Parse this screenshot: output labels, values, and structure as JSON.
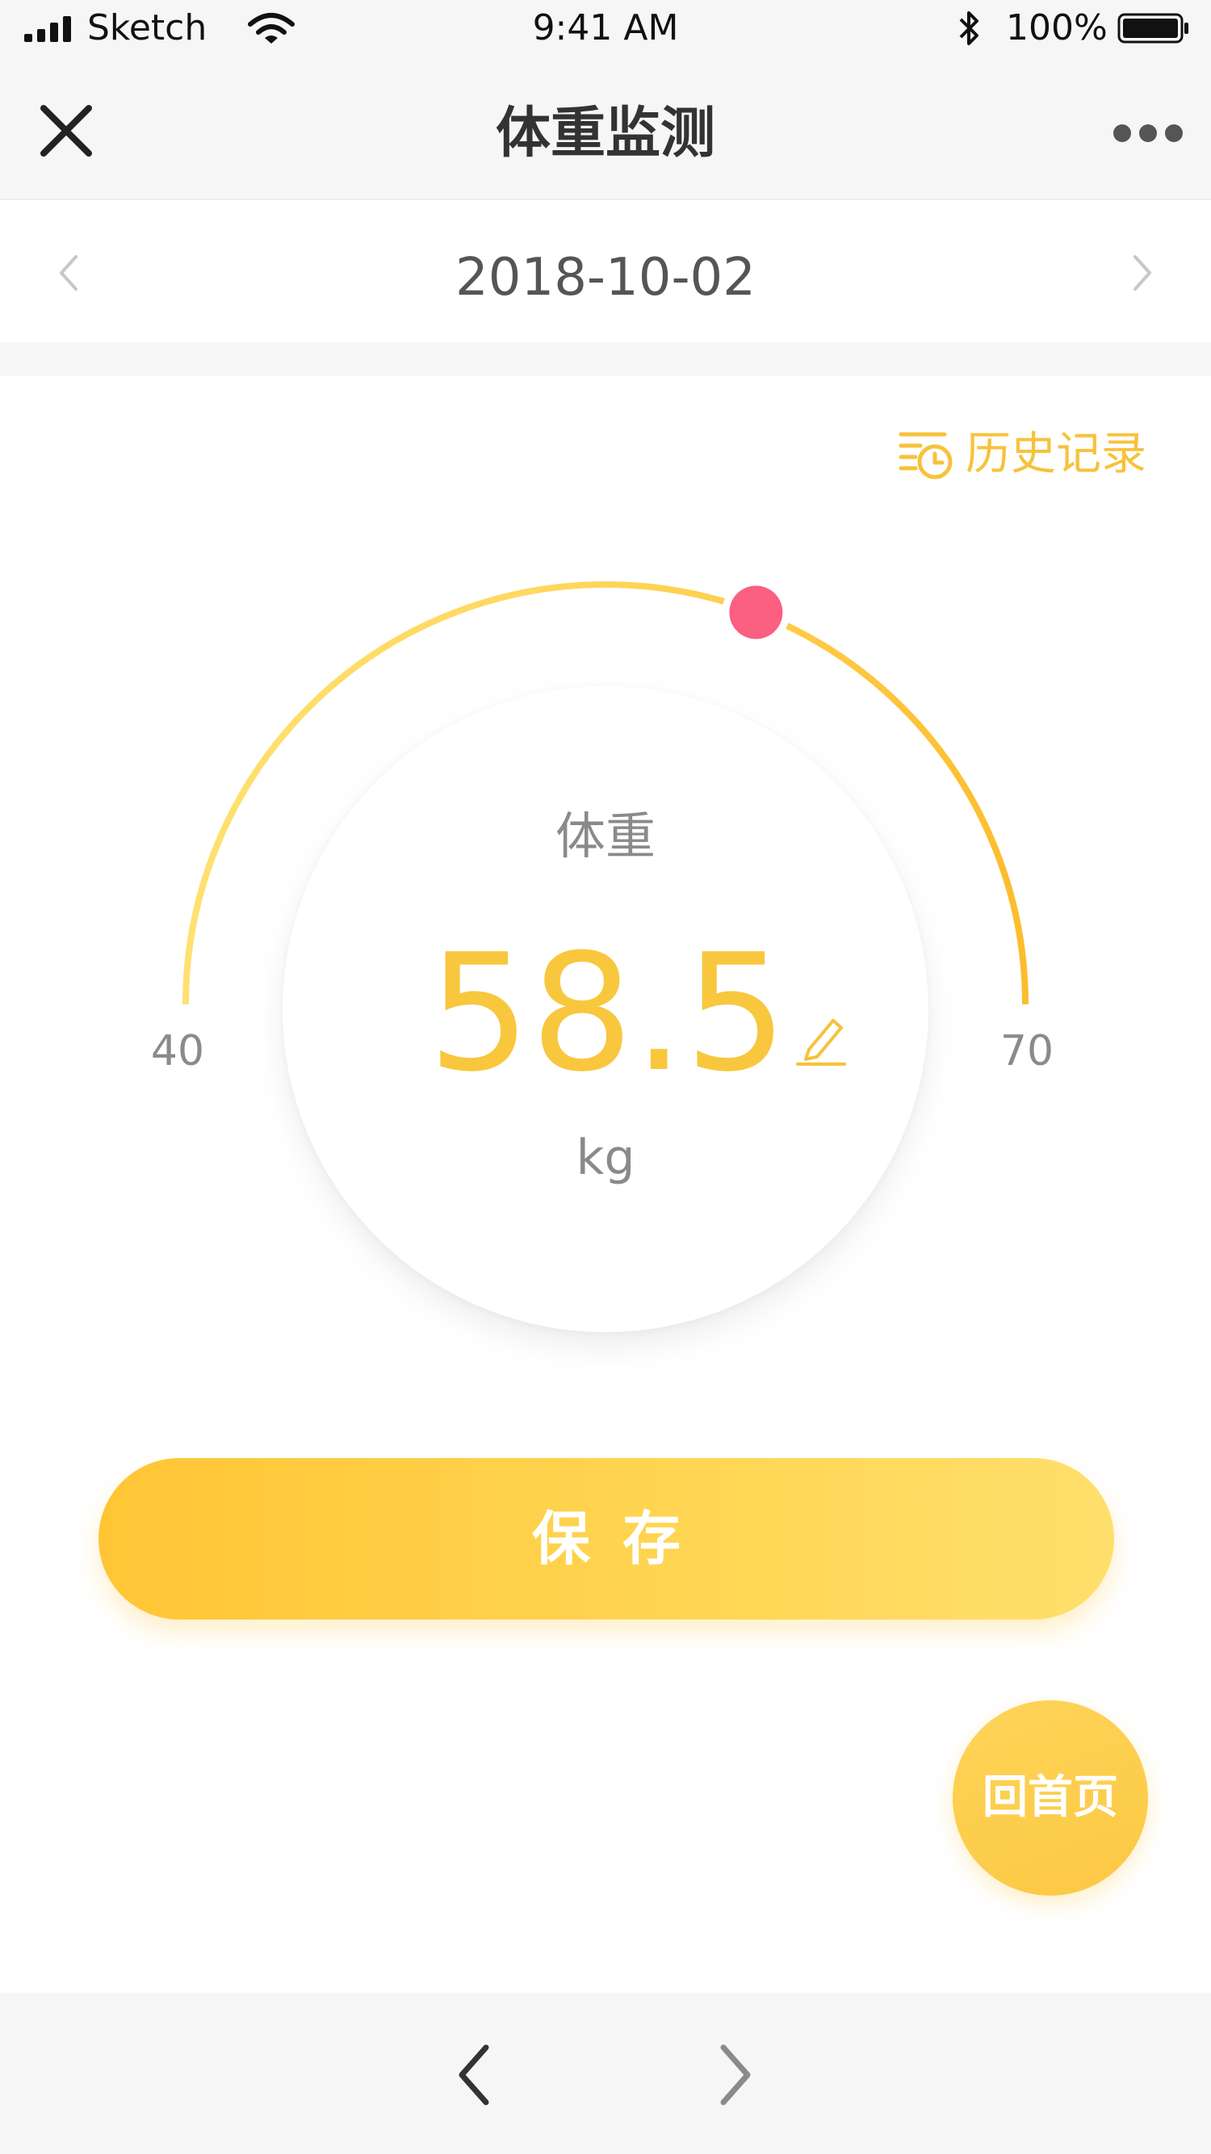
{
  "status_bar": {
    "carrier": "Sketch",
    "time": "9:41 AM",
    "battery_percent": "100%",
    "icons": [
      "signal-icon",
      "wifi-icon",
      "bluetooth-icon",
      "battery-icon"
    ]
  },
  "nav": {
    "title": "体重监测",
    "icons": [
      "close-icon",
      "more-icon"
    ]
  },
  "date_bar": {
    "date": "2018-10-02",
    "icons": [
      "chevron-left-icon",
      "chevron-right-icon"
    ]
  },
  "history": {
    "label": "历史记录",
    "icon": "history-list-icon"
  },
  "gauge": {
    "label": "体重",
    "value": "58.5",
    "unit": "kg",
    "min": "40",
    "max": "70",
    "current": 58.5,
    "range": [
      40,
      70
    ],
    "edit_icon": "pencil-icon"
  },
  "save_button": {
    "label": "保存"
  },
  "home_button": {
    "label": "回首页"
  },
  "bottom_bar": {
    "icons": [
      "back-arrow-icon",
      "forward-arrow-icon"
    ]
  },
  "colors": {
    "accent": "#f8c73d",
    "gradient_start": "#ffc535",
    "gradient_end": "#ffdf6c",
    "knob": "#fb5f81",
    "background": "#f6f6f6"
  }
}
